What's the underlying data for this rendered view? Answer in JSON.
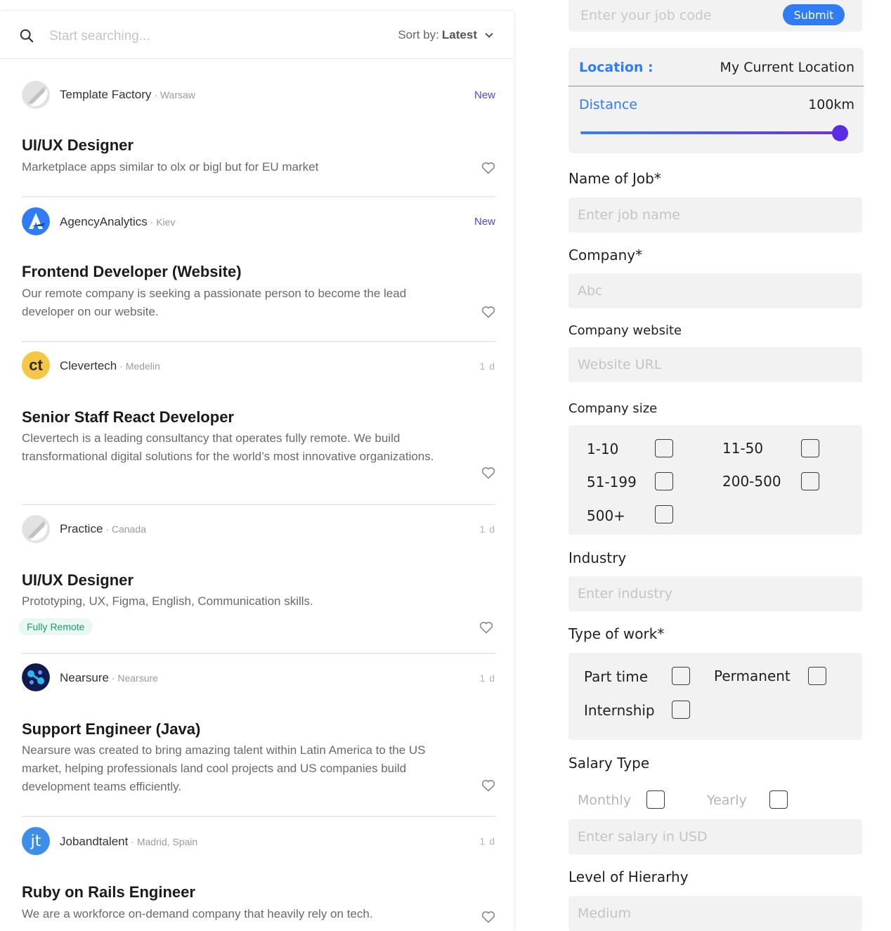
{
  "search": {
    "placeholder": "Start searching...",
    "sort_label": "Sort by:",
    "sort_value": "Latest"
  },
  "jobs": [
    {
      "company": "Template Factory",
      "location": "Warsaw",
      "tag": "New",
      "title": "UI/UX Designer",
      "description": "Marketplace apps similar to olx or bigl but for EU market",
      "badge": ""
    },
    {
      "company": "AgencyAnalytics",
      "location": "Kiev",
      "tag": "New",
      "title": "Frontend Developer (Website)",
      "description": "Our remote company is seeking a passionate person to become the lead developer on our website.",
      "badge": ""
    },
    {
      "company": "Clevertech",
      "location": "Medelin",
      "tag": "1 d",
      "title": "Senior Staff React Developer",
      "description": "Clevertech is a leading consultancy that operates fully remote. We build transformational digital solutions for the world’s most innovative organizations.",
      "badge": "",
      "logo_text": "ct"
    },
    {
      "company": "Practice",
      "location": "Canada",
      "tag": "1 d",
      "title": "UI/UX Designer",
      "description": "Prototyping, UX, Figma, English, Communication skills.",
      "badge": "Fully Remote"
    },
    {
      "company": "Nearsure",
      "location": "Nearsure",
      "tag": "1 d",
      "title": "Support Engineer (Java)",
      "description": "Nearsure was created to bring amazing talent within Latin America to the US market, helping professionals land cool projects and US companies build development teams efficiently.",
      "badge": ""
    },
    {
      "company": "Jobandtalent",
      "location": "Madrid, Spain",
      "tag": "1 d",
      "title": "Ruby on Rails Engineer",
      "description": "We are a workforce on-demand company that heavily rely on tech.",
      "badge": "",
      "logo_text": "jt"
    }
  ],
  "form": {
    "jobcode_placeholder": "Enter your job code",
    "submit_label": "Submit",
    "location_label": "Location :",
    "location_value": "My Current Location",
    "distance_label": "Distance",
    "distance_value": "100km",
    "distance_fraction": 0.97,
    "job_name_label": "Name of Job*",
    "job_name_placeholder": "Enter job name",
    "company_label": "Company*",
    "company_placeholder": "Abc",
    "website_label": "Company website",
    "website_placeholder": "Website URL",
    "size_label": "Company size",
    "sizes": [
      "1-10",
      "11-50",
      "51-199",
      "200-500",
      "500+"
    ],
    "industry_label": "Industry",
    "industry_placeholder": "Enter industry",
    "work_type_label": "Type of work*",
    "work_types": [
      "Part time",
      "Permanent",
      "Internship"
    ],
    "salary_type_label": "Salary Type",
    "salary_types": [
      "Monthly",
      "Yearly"
    ],
    "salary_placeholder": "Enter salary in USD",
    "hierarchy_label": "Level of Hierarhy",
    "hierarchy_placeholder": "Medium"
  },
  "colors": {
    "accent": "#2f7cf6",
    "new_tag": "#5b3fd8",
    "slider_thumb": "#5a2ce6",
    "badge_text": "#1b9b72"
  }
}
